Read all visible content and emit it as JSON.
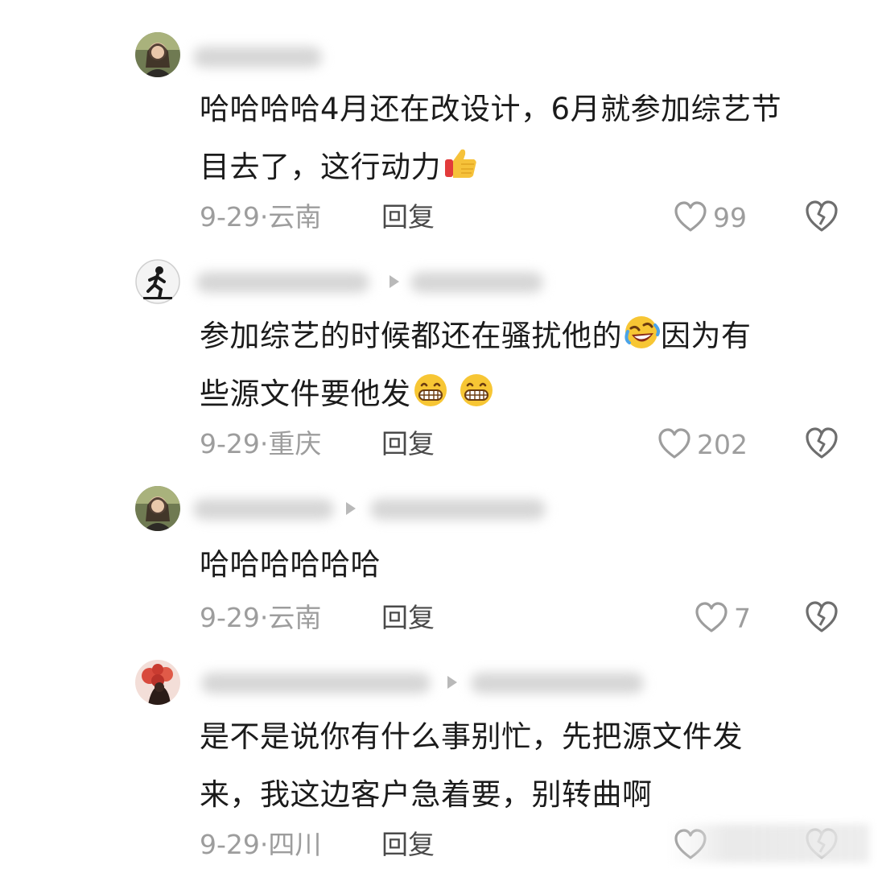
{
  "comments": [
    {
      "lines": [
        "哈哈哈哈4月还在改设计，6月就参加综艺节",
        "目去了，这行动力"
      ],
      "emojis_line2": [
        "thumbs-up-emoji"
      ],
      "date": "9-29",
      "location": "云南",
      "reply_label": "回复",
      "likes": "99"
    },
    {
      "lines_a": [
        "参加综艺的时候都还在骚扰他的",
        "因为有"
      ],
      "line2": "些源文件要他发",
      "emojis": [
        "rofl-emoji",
        "grin-emoji",
        "grin-emoji"
      ],
      "date": "9-29",
      "location": "重庆",
      "reply_label": "回复",
      "likes": "202"
    },
    {
      "lines": [
        "哈哈哈哈哈哈"
      ],
      "date": "9-29",
      "location": "云南",
      "reply_label": "回复",
      "likes": "7"
    },
    {
      "lines": [
        "是不是说你有什么事别忙，先把源文件发",
        "来，我这边客户急着要，别转曲啊"
      ],
      "date": "9-29",
      "location": "四川",
      "reply_label": "回复"
    }
  ],
  "meta_separator": "·",
  "icons": {
    "like": "heart-outline-icon",
    "dislike": "broken-heart-icon"
  },
  "colors": {
    "text": "#1b1b1b",
    "meta": "#9d9d9d",
    "reply": "#4a4a4a",
    "background": "#ffffff"
  }
}
